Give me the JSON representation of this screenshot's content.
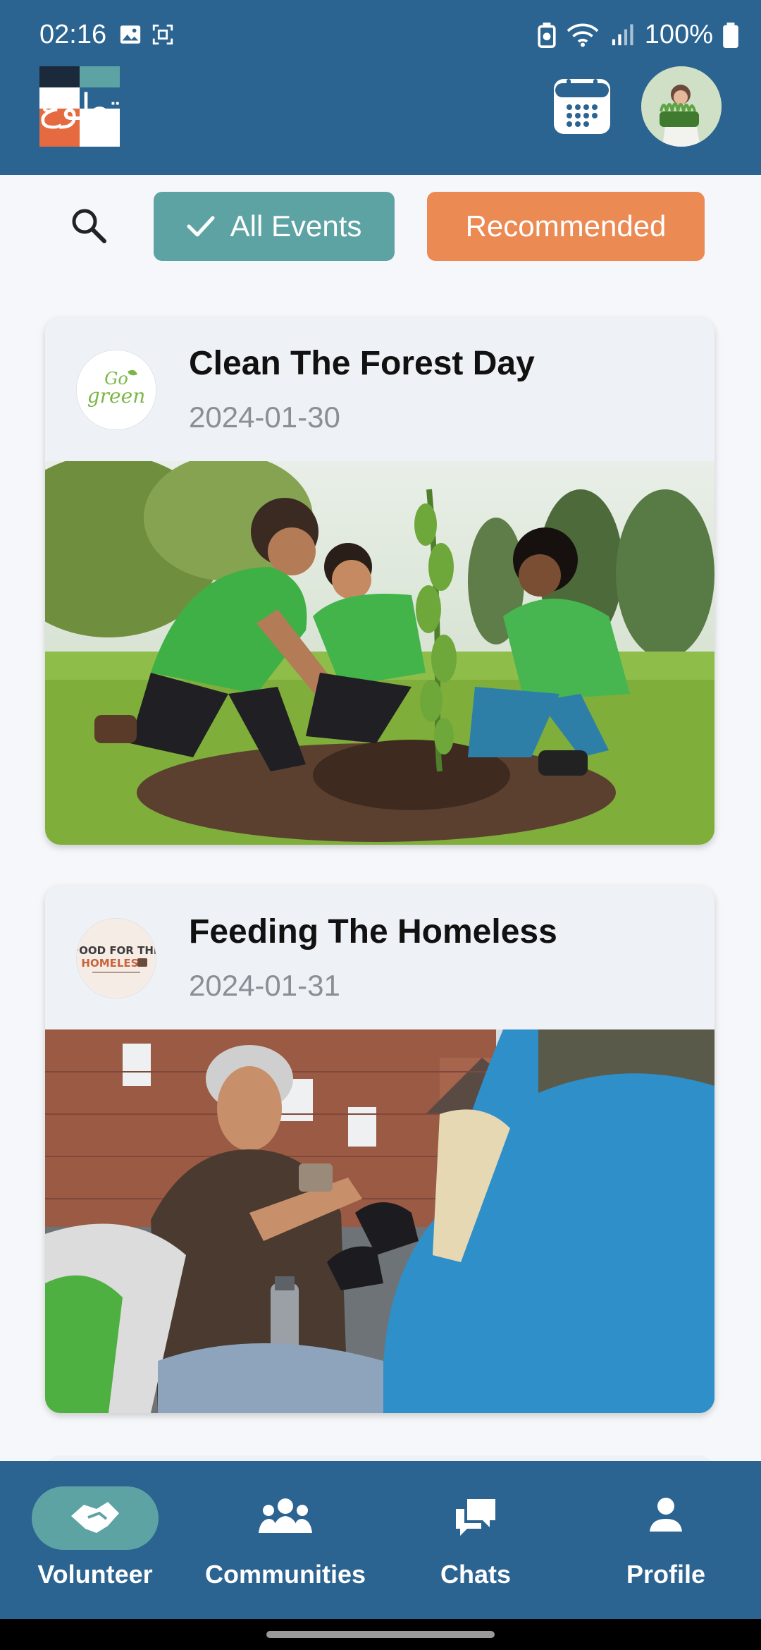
{
  "status_bar": {
    "time": "02:16",
    "battery": "100%"
  },
  "header": {
    "logo_text": "تطوع"
  },
  "filters": {
    "all_events_label": "All Events",
    "recommended_label": "Recommended"
  },
  "events": [
    {
      "title": "Clean The Forest Day",
      "date": "2024-01-30",
      "org_logo_text": "Go green"
    },
    {
      "title": "Feeding The Homeless",
      "date": "2024-01-31",
      "org_logo_text": "FOOD FOR THE HOMELESS"
    }
  ],
  "bottom_nav": [
    {
      "label": "Volunteer",
      "active": true
    },
    {
      "label": "Communities",
      "active": false
    },
    {
      "label": "Chats",
      "active": false
    },
    {
      "label": "Profile",
      "active": false
    }
  ],
  "colors": {
    "primary": "#2b6391",
    "teal": "#5ea3a3",
    "orange": "#ec8a54"
  }
}
